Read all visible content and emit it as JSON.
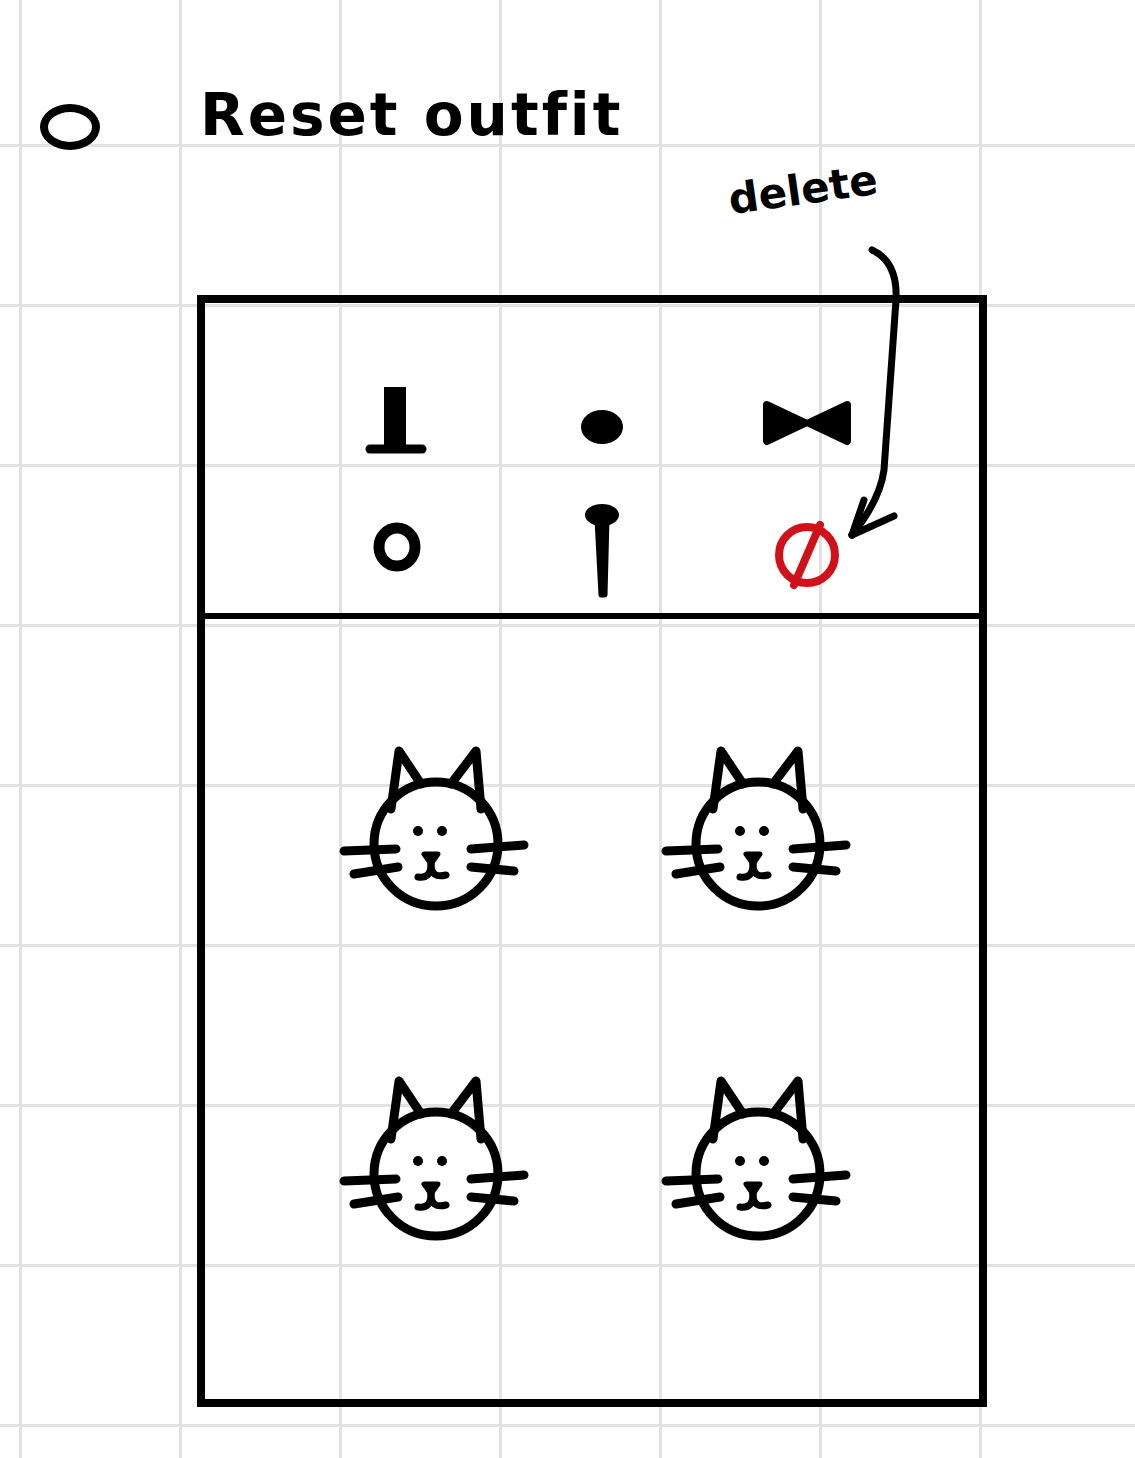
{
  "radio": {
    "label": "Reset outfit",
    "selected": false
  },
  "annotation": {
    "text": "delete"
  },
  "accessories": [
    {
      "kind": "accessory",
      "color": "#000000"
    },
    {
      "kind": "accessory",
      "color": "#000000"
    },
    {
      "kind": "accessory",
      "color": "#000000"
    },
    {
      "kind": "accessory",
      "color": "#000000"
    },
    {
      "kind": "accessory",
      "color": "#000000"
    },
    {
      "kind": "delete",
      "color": "#d0111a"
    }
  ],
  "cats": [
    {},
    {},
    {},
    {}
  ]
}
